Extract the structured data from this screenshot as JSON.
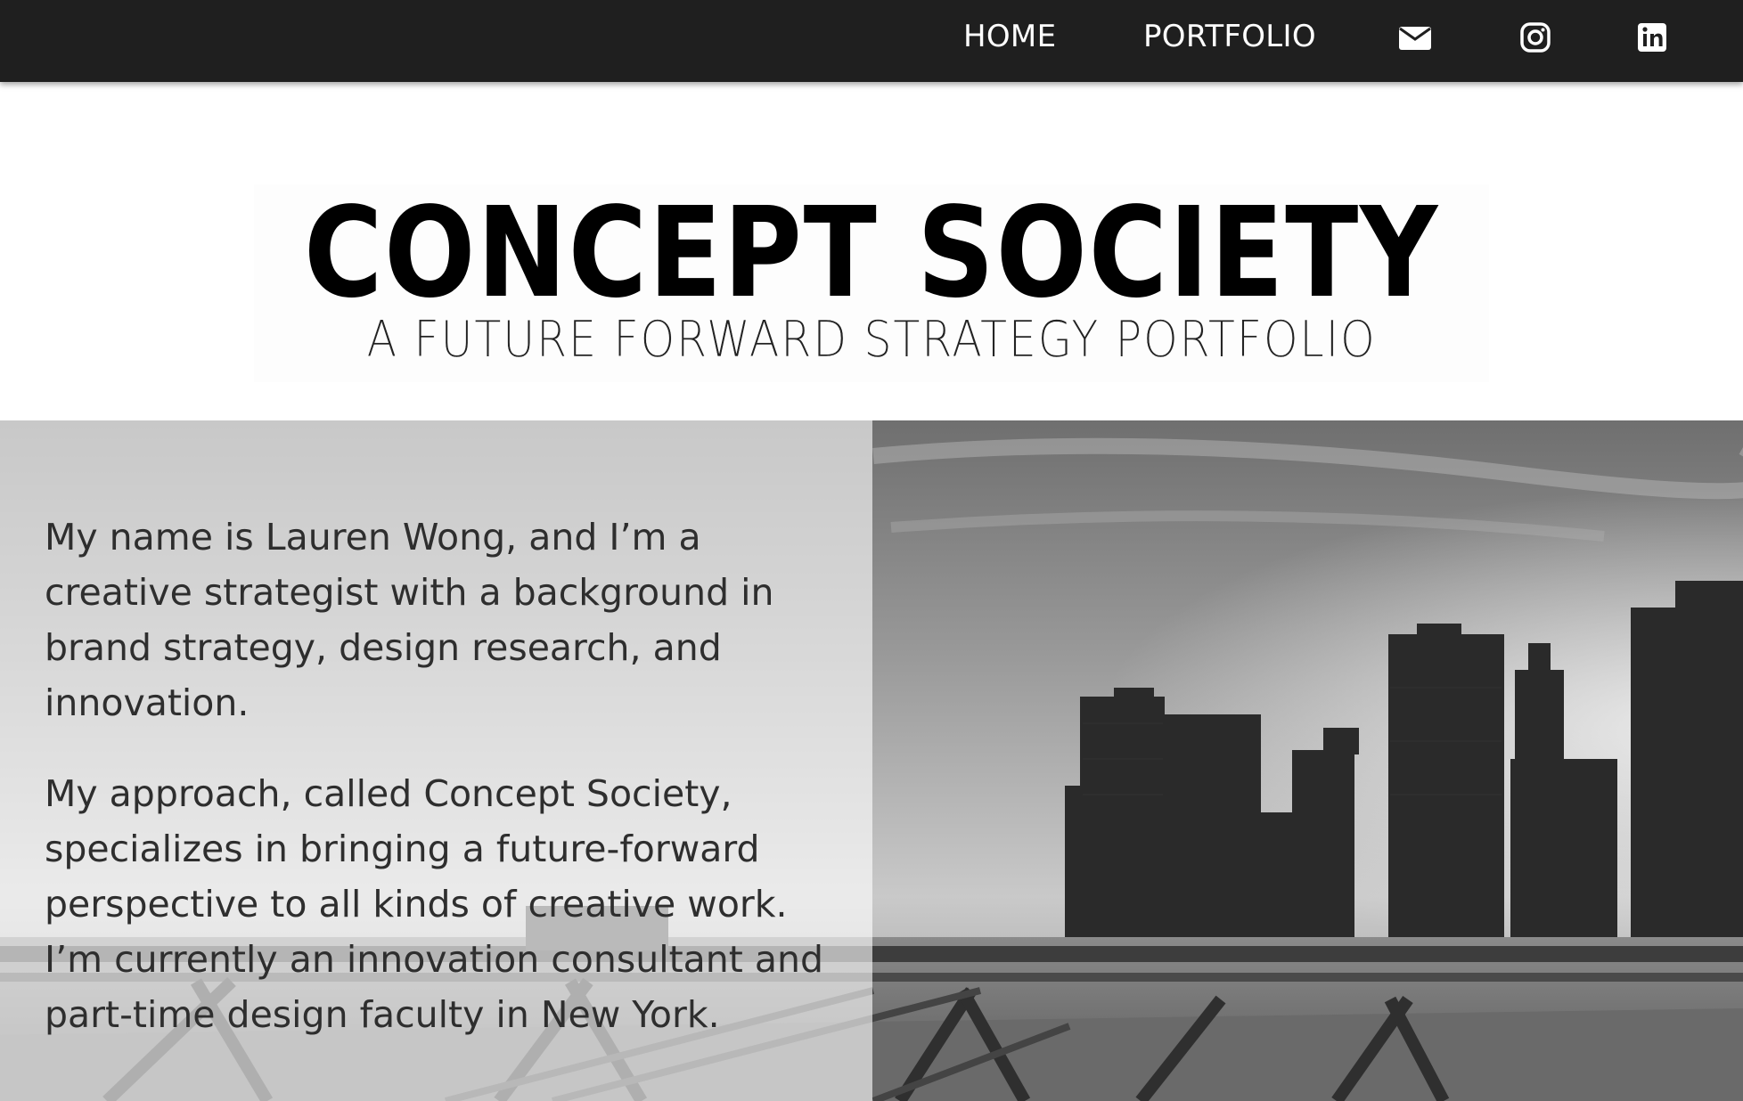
{
  "nav": {
    "home_label": "HOME",
    "portfolio_label": "PORTFOLIO",
    "icons": [
      "envelope-icon",
      "instagram-icon",
      "linkedin-icon"
    ]
  },
  "logo": {
    "title": "CONCEPT SOCIETY",
    "subtitle": "A FUTURE FORWARD STRATEGY PORTFOLIO"
  },
  "hero": {
    "paragraph_1": "My name is Lauren Wong, and I’m a creative strategist with a background in brand strategy, design research, and innovation.",
    "paragraph_2": "My approach, called Concept Society, specializes in bringing a future-forward perspective to all kinds of creative work. I’m currently an innovation consultant and part-time design faculty in New York."
  },
  "colors": {
    "nav_background": "#1f1f1f",
    "nav_text": "#ffffff",
    "body_text": "#2e2e2e",
    "logo_text": "#000000"
  }
}
